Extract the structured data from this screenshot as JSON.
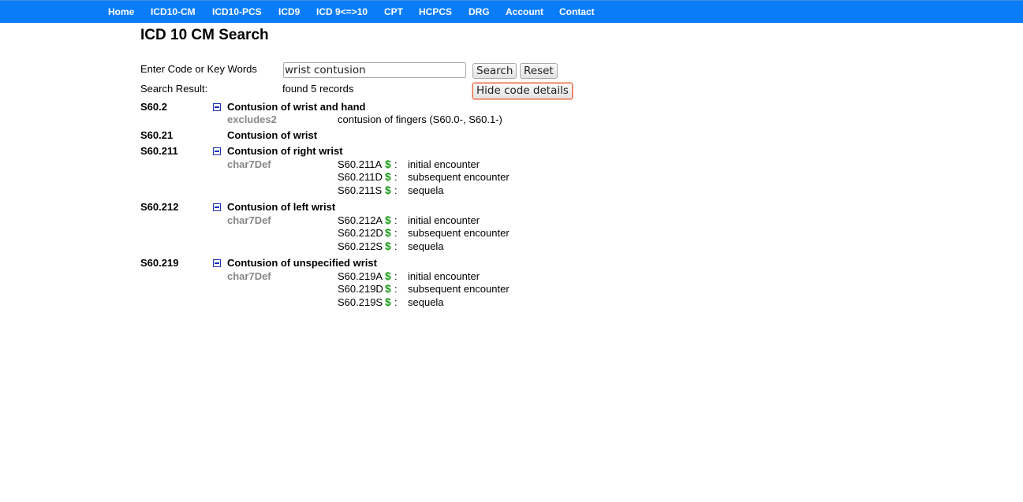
{
  "nav": {
    "items": [
      "Home",
      "ICD10-CM",
      "ICD10-PCS",
      "ICD9",
      "ICD 9<=>10",
      "CPT",
      "HCPCS",
      "DRG",
      "Account",
      "Contact"
    ]
  },
  "page": {
    "title": "ICD 10 CM Search"
  },
  "search": {
    "label": "Enter Code or Key Words",
    "value": "wrist contusion",
    "search_button": "Search",
    "reset_button": "Reset",
    "result_label": "Search Result:",
    "result_text": "found 5 records",
    "hide_details_button": "Hide code details"
  },
  "results": [
    {
      "code": "S60.2",
      "description": "Contusion of wrist and hand",
      "sublabel": "excludes2",
      "subtext": "contusion of fingers (S60.0-, S60.1-)"
    },
    {
      "code": "S60.21",
      "description": "Contusion of wrist"
    },
    {
      "code": "S60.211",
      "description": "Contusion of right wrist",
      "sublabel": "char7Def",
      "char7": [
        {
          "code": "S60.211A",
          "desc": "initial encounter"
        },
        {
          "code": "S60.211D",
          "desc": "subsequent encounter"
        },
        {
          "code": "S60.211S",
          "desc": "sequela"
        }
      ]
    },
    {
      "code": "S60.212",
      "description": "Contusion of left wrist",
      "sublabel": "char7Def",
      "char7": [
        {
          "code": "S60.212A",
          "desc": "initial encounter"
        },
        {
          "code": "S60.212D",
          "desc": "subsequent encounter"
        },
        {
          "code": "S60.212S",
          "desc": "sequela"
        }
      ]
    },
    {
      "code": "S60.219",
      "description": "Contusion of unspecified wrist",
      "sublabel": "char7Def",
      "char7": [
        {
          "code": "S60.219A",
          "desc": "initial encounter"
        },
        {
          "code": "S60.219D",
          "desc": "subsequent encounter"
        },
        {
          "code": "S60.219S",
          "desc": "sequela"
        }
      ]
    }
  ],
  "symbols": {
    "dollar": "$",
    "colon": ":"
  },
  "colors": {
    "nav_bg": "#0a7cf8",
    "dollar": "#1a9a1a",
    "sublabel": "#888888",
    "toggle": "#1a2fbf",
    "focus_border": "#e9704a"
  }
}
